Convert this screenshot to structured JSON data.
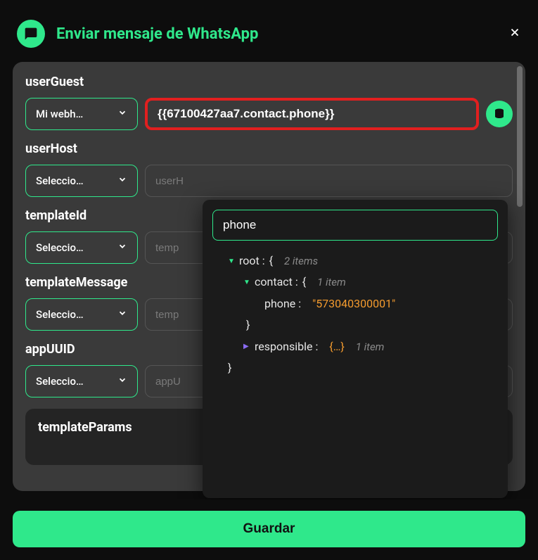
{
  "header": {
    "title": "Enviar mensaje de WhatsApp"
  },
  "fields": {
    "userGuest": {
      "label": "userGuest",
      "select": "Mi webh…",
      "value": "{{67100427aa7.contact.phone}}"
    },
    "userHost": {
      "label": "userHost",
      "select": "Seleccio…",
      "placeholder": "userH"
    },
    "templateId": {
      "label": "templateId",
      "select": "Seleccio…",
      "placeholder": "temp"
    },
    "templateMessage": {
      "label": "templateMessage",
      "select": "Seleccio…",
      "placeholder": "temp"
    },
    "appUUID": {
      "label": "appUUID",
      "select": "Seleccio…",
      "placeholder": "appU"
    },
    "templateParams": {
      "label": "templateParams"
    }
  },
  "popover": {
    "search": "phone",
    "tree": {
      "root_label": "root :",
      "root_count": "2 items",
      "contact_label": "contact :",
      "contact_count": "1 item",
      "phone_label": "phone :",
      "phone_value": "\"573040300001\"",
      "responsible_label": "responsible :",
      "responsible_count": "1 item",
      "brace_open": "{",
      "brace_close": "}",
      "dots": "{…}"
    }
  },
  "footer": {
    "save": "Guardar"
  }
}
